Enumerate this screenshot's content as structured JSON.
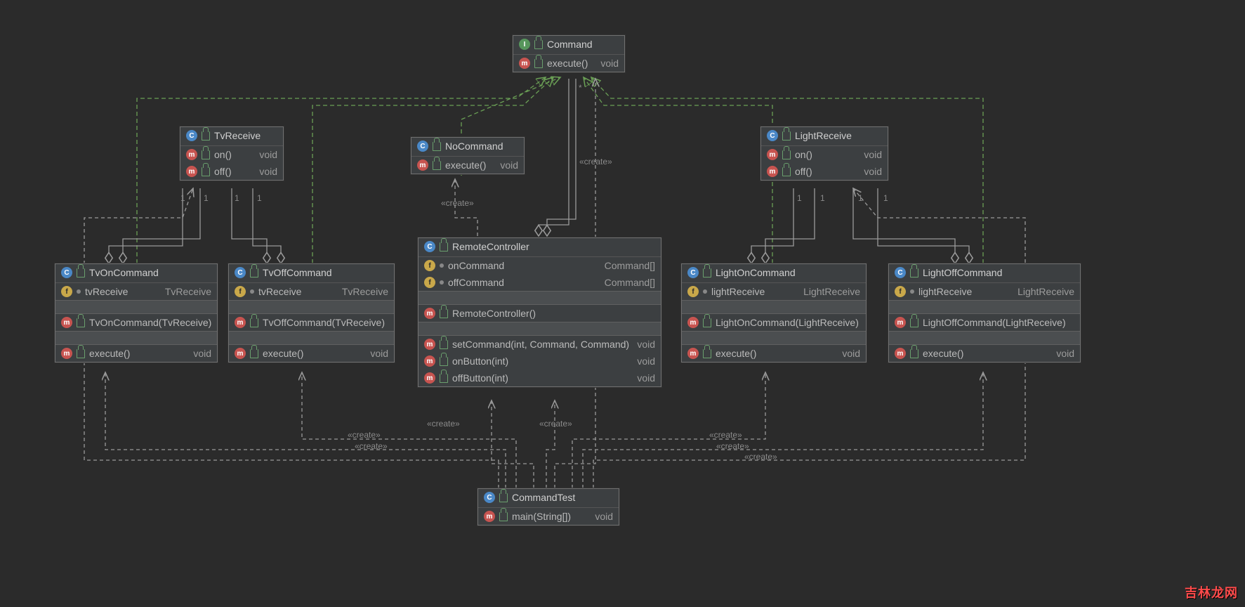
{
  "watermark": "吉林龙网",
  "labels": {
    "create1": "«create»",
    "create2": "«create»",
    "create3": "«create»",
    "create4": "«create»",
    "create5": "«create»",
    "create6": "«create»",
    "create7": "«create»",
    "create8": "«create»",
    "create9": "«create»",
    "one_a": "1",
    "one_b": "1",
    "one_c": "1",
    "one_d": "1",
    "one_e": "1",
    "one_f": "1",
    "one_g": "1",
    "one_h": "1",
    "star": "*"
  },
  "classes": {
    "command": {
      "kind": "I",
      "name": "Command",
      "members": [
        {
          "icon": "m",
          "name": "execute()",
          "type": "void"
        }
      ]
    },
    "tvReceive": {
      "kind": "C",
      "name": "TvReceive",
      "members": [
        {
          "icon": "m",
          "name": "on()",
          "type": "void"
        },
        {
          "icon": "m",
          "name": "off()",
          "type": "void"
        }
      ]
    },
    "lightReceive": {
      "kind": "C",
      "name": "LightReceive",
      "members": [
        {
          "icon": "m",
          "name": "on()",
          "type": "void"
        },
        {
          "icon": "m",
          "name": "off()",
          "type": "void"
        }
      ]
    },
    "noCommand": {
      "kind": "C",
      "name": "NoCommand",
      "members": [
        {
          "icon": "m",
          "name": "execute()",
          "type": "void"
        }
      ]
    },
    "tvOnCommand": {
      "kind": "C",
      "name": "TvOnCommand",
      "fields": [
        {
          "icon": "f",
          "name": "tvReceive",
          "type": "TvReceive"
        }
      ],
      "ctor": [
        {
          "icon": "m",
          "name": "TvOnCommand(TvReceive)",
          "type": ""
        }
      ],
      "methods": [
        {
          "icon": "m",
          "name": "execute()",
          "type": "void"
        }
      ]
    },
    "tvOffCommand": {
      "kind": "C",
      "name": "TvOffCommand",
      "fields": [
        {
          "icon": "f",
          "name": "tvReceive",
          "type": "TvReceive"
        }
      ],
      "ctor": [
        {
          "icon": "m",
          "name": "TvOffCommand(TvReceive)",
          "type": ""
        }
      ],
      "methods": [
        {
          "icon": "m",
          "name": "execute()",
          "type": "void"
        }
      ]
    },
    "lightOnCommand": {
      "kind": "C",
      "name": "LightOnCommand",
      "fields": [
        {
          "icon": "f",
          "name": "lightReceive",
          "type": "LightReceive"
        }
      ],
      "ctor": [
        {
          "icon": "m",
          "name": "LightOnCommand(LightReceive)",
          "type": ""
        }
      ],
      "methods": [
        {
          "icon": "m",
          "name": "execute()",
          "type": "void"
        }
      ]
    },
    "lightOffCommand": {
      "kind": "C",
      "name": "LightOffCommand",
      "fields": [
        {
          "icon": "f",
          "name": "lightReceive",
          "type": "LightReceive"
        }
      ],
      "ctor": [
        {
          "icon": "m",
          "name": "LightOffCommand(LightReceive)",
          "type": ""
        }
      ],
      "methods": [
        {
          "icon": "m",
          "name": "execute()",
          "type": "void"
        }
      ]
    },
    "remoteController": {
      "kind": "C",
      "name": "RemoteController",
      "fields": [
        {
          "icon": "f",
          "name": "onCommand",
          "type": "Command[]"
        },
        {
          "icon": "f",
          "name": "offCommand",
          "type": "Command[]"
        }
      ],
      "ctor": [
        {
          "icon": "m",
          "name": "RemoteController()",
          "type": ""
        }
      ],
      "methods": [
        {
          "icon": "m",
          "name": "setCommand(int, Command, Command)",
          "type": "void"
        },
        {
          "icon": "m",
          "name": "onButton(int)",
          "type": "void"
        },
        {
          "icon": "m",
          "name": "offButton(int)",
          "type": "void"
        }
      ]
    },
    "commandTest": {
      "kind": "C",
      "name": "CommandTest",
      "members": [
        {
          "icon": "m",
          "name": "main(String[])",
          "type": "void"
        }
      ]
    }
  }
}
